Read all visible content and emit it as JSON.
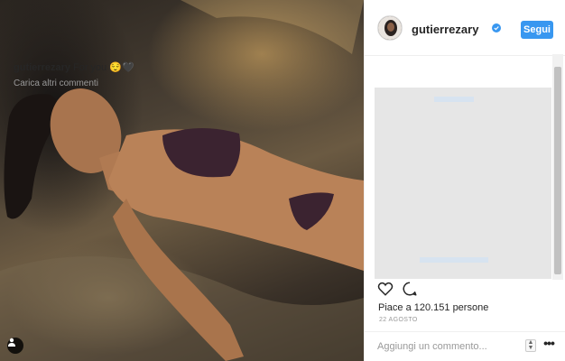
{
  "post": {
    "username": "gutierrezary",
    "verified": true,
    "follow_label": "Segui",
    "caption_text": "For you 😌🖤",
    "load_more_comments": "Carica altri commenti",
    "likes_text": "Piace a 120.151 persone",
    "date": "22 AGOSTO",
    "comment_placeholder": "Aggiungi un commento...",
    "more_options_label": "•••"
  },
  "icons": {
    "like": "heart-outline-icon",
    "comment": "speech-bubble-icon",
    "verified": "verified-badge-icon",
    "user_tag": "person-icon"
  },
  "colors": {
    "accent": "#3897f0",
    "text": "#262626",
    "muted": "#999999",
    "placeholder_box": "#e6e6e6"
  }
}
